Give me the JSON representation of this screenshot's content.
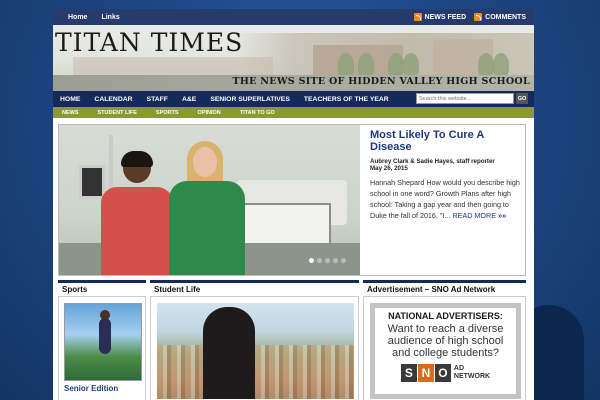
{
  "topbar": {
    "links": [
      "Home",
      "Links"
    ],
    "feeds": [
      "NEWS FEED",
      "COMMENTS"
    ]
  },
  "header": {
    "logo": "TITAN TIMES",
    "tagline": "THE NEWS SITE OF HIDDEN VALLEY HIGH SCHOOL"
  },
  "mainnav": {
    "items": [
      "HOME",
      "CALENDAR",
      "STAFF",
      "A&E",
      "SENIOR SUPERLATIVES",
      "TEACHERS OF THE YEAR"
    ],
    "search_placeholder": "Search this website...",
    "go_label": "GO"
  },
  "subnav": {
    "items": [
      "NEWS",
      "STUDENT LIFE",
      "SPORTS",
      "OPINION",
      "TITAN TO GO"
    ]
  },
  "featured": {
    "title": "Most Likely To Cure A Disease",
    "byline": "Aubrey Clark & Sadie Hayes, staff reporter",
    "date": "May 26, 2015",
    "excerpt": "Hannah Shepard  How would you describe high school in one word? Growth Plans after high school: Taking a gap year and then going to Duke the fall of 2016. \"I...",
    "readmore": "READ MORE",
    "chevrons": "»»",
    "slides_active": 1
  },
  "sections": {
    "sports": {
      "title": "Sports",
      "caption": "Senior Edition"
    },
    "student_life": {
      "title": "Student Life"
    },
    "advertisement": {
      "title": "Advertisement – SNO Ad Network",
      "ad_heading": "NATIONAL ADVERTISERS:",
      "ad_text": "Want to reach a diverse audience of high school and college students?",
      "logo_letters": [
        "S",
        "N",
        "O"
      ],
      "logo_word1": "AD",
      "logo_word2": "NETWORK"
    }
  },
  "colors": {
    "nav_dark": "#15295a",
    "subnav_green": "#8a9a32",
    "link_blue": "#1c3a7a",
    "background_blue": "#1c4580"
  }
}
